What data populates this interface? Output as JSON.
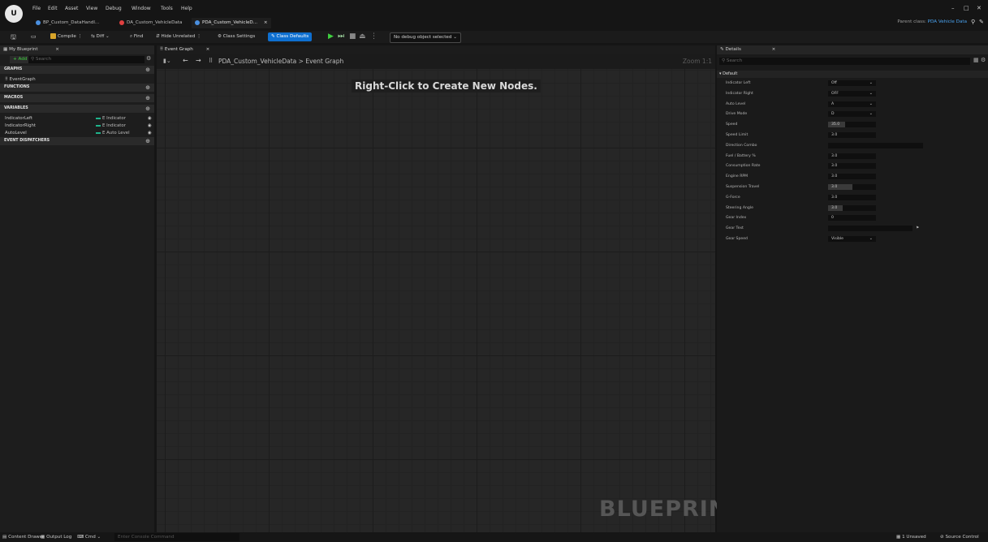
{
  "menu": [
    "File",
    "Edit",
    "Asset",
    "View",
    "Debug",
    "Window",
    "Tools",
    "Help"
  ],
  "logo_text": "U",
  "tabs": [
    {
      "label": "BP_Custom_DataHandl...",
      "color": "#4a8fe0"
    },
    {
      "label": "DA_Custom_VehicleData",
      "color": "#e04040"
    },
    {
      "label": "PDA_Custom_VehicleD...",
      "color": "#4a8fe0"
    }
  ],
  "tab_close": "×",
  "window_controls": {
    "minimize": "–",
    "maximize": "□",
    "close": "✕"
  },
  "parent_class": {
    "label": "Parent class:",
    "value": "PDA Vehicle Data"
  },
  "toolbar": {
    "compile": "Compile",
    "diff": "Diff",
    "find": "Find",
    "hide_unrelated": "Hide Unrelated",
    "class_settings": "Class Settings",
    "class_defaults": "Class Defaults",
    "debug_select": "No debug object selected"
  },
  "colors": {
    "accent": "#0e6fd0",
    "play": "#3fd03f",
    "variable_type": "#1fb38b",
    "breadcrumb_accent": "#4aa3f0"
  },
  "left_panel": {
    "tab": "My Blueprint",
    "add_button": "+ Add",
    "search_placeholder": "Search",
    "sections": {
      "graphs": "GRAPHS",
      "functions": "FUNCTIONS",
      "macros": "MACROS",
      "variables": "VARIABLES",
      "dispatchers": "EVENT DISPATCHERS"
    },
    "graph_items": [
      "EventGraph"
    ],
    "variables": [
      {
        "name": "IndicatorLeft",
        "type": "E Indicator"
      },
      {
        "name": "IndicatorRight",
        "type": "E Indicator"
      },
      {
        "name": "AutoLevel",
        "type": "E Auto Level"
      }
    ]
  },
  "graph": {
    "tab": "Event Graph",
    "breadcrumb_root": "PDA_Custom_VehicleData",
    "breadcrumb_sep": ">",
    "breadcrumb_leaf": "Event Graph",
    "zoom": "Zoom 1:1",
    "hint": "Right-Click to Create New Nodes.",
    "watermark": "BLUEPRINT"
  },
  "details": {
    "tab": "Details",
    "search_placeholder": "Search",
    "category": "Default",
    "rows": [
      {
        "label": "Indicator Left",
        "value": "Off",
        "kind": "drop"
      },
      {
        "label": "Indicator Right",
        "value": "OFF",
        "kind": "drop"
      },
      {
        "label": "Auto Level",
        "value": "A",
        "kind": "drop"
      },
      {
        "label": "Drive Mode",
        "value": "D",
        "kind": "drop"
      },
      {
        "label": "Speed",
        "value": "35.0",
        "kind": "slider",
        "fill": 0.35
      },
      {
        "label": "Speed Limit",
        "value": "3.0",
        "kind": "num"
      },
      {
        "label": "Direction Combo",
        "value": "",
        "kind": "wide"
      },
      {
        "label": "Fuel / Battery %",
        "value": "3.0",
        "kind": "num"
      },
      {
        "label": "Consumption Rate",
        "value": "3.0",
        "kind": "num"
      },
      {
        "label": "Engine RPM",
        "value": "3.0",
        "kind": "num"
      },
      {
        "label": "Suspension Travel",
        "value": "3.0",
        "kind": "slider",
        "fill": 0.5
      },
      {
        "label": "G-Force",
        "value": "3.0",
        "kind": "num"
      },
      {
        "label": "Steering Angle",
        "value": "3.0",
        "kind": "slider",
        "fill": 0.3
      },
      {
        "label": "Gear Index",
        "value": "0",
        "kind": "num"
      },
      {
        "label": "Gear Text",
        "value": "",
        "kind": "text"
      },
      {
        "label": "Gear Speed",
        "value": "Visible",
        "kind": "drop"
      }
    ]
  },
  "status_bar": {
    "content_drawer": "Content Drawer",
    "output_log": "Output Log",
    "cmd": "Cmd",
    "console_placeholder": "Enter Console Command",
    "unsaved": "1 Unsaved",
    "source_control": "Source Control"
  }
}
